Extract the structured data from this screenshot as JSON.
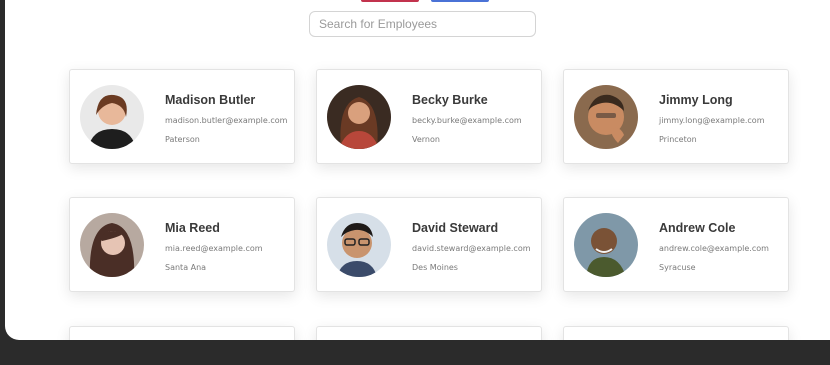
{
  "search": {
    "placeholder": "Search for Employees",
    "value": ""
  },
  "employees": [
    {
      "name": "Madison Butler",
      "email": "madison.butler@example.com",
      "city": "Paterson"
    },
    {
      "name": "Becky Burke",
      "email": "becky.burke@example.com",
      "city": "Vernon"
    },
    {
      "name": "Jimmy Long",
      "email": "jimmy.long@example.com",
      "city": "Princeton"
    },
    {
      "name": "Mia Reed",
      "email": "mia.reed@example.com",
      "city": "Santa Ana"
    },
    {
      "name": "David Steward",
      "email": "david.steward@example.com",
      "city": "Des Moines"
    },
    {
      "name": "Andrew Cole",
      "email": "andrew.cole@example.com",
      "city": "Syracuse"
    }
  ],
  "colors": {
    "background": "#2b2b2b",
    "panel": "#ffffff",
    "top_button_red": "#c2334d",
    "top_button_blue": "#4a72d6"
  }
}
